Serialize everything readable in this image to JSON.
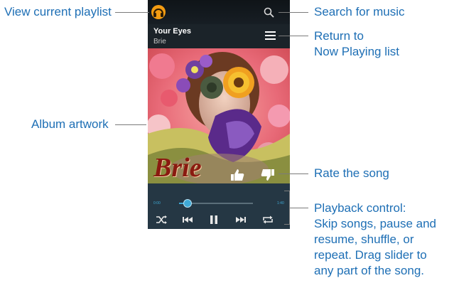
{
  "player": {
    "song_title": "Your Eyes",
    "song_artist": "Brie",
    "artwork_word": "Brie",
    "current_time": "0:00",
    "total_time": "1:40",
    "progress": 0.12
  },
  "annotations": {
    "view_playlist": "View current playlist",
    "search": "Search for music",
    "return_line1": "Return to",
    "return_line2": "Now Playing list",
    "album_artwork": "Album artwork",
    "rate": "Rate the song",
    "playback_lines": [
      "Playback control:",
      "Skip songs, pause and",
      "resume, shuffle, or",
      "repeat. Drag slider to",
      "any part of the song."
    ]
  },
  "icons": {
    "app": "headphones-icon",
    "search": "search-icon",
    "list": "list-icon",
    "like": "thumbs-up-icon",
    "dislike": "thumbs-down-icon",
    "shuffle": "shuffle-icon",
    "previous": "skip-previous-icon",
    "pause": "pause-icon",
    "next": "skip-next-icon",
    "repeat": "repeat-icon"
  },
  "colors": {
    "annotation_text": "#1e6fb5",
    "accent": "#3fa9d6",
    "control_bar": "#253744",
    "app_icon": "#f39c12"
  }
}
